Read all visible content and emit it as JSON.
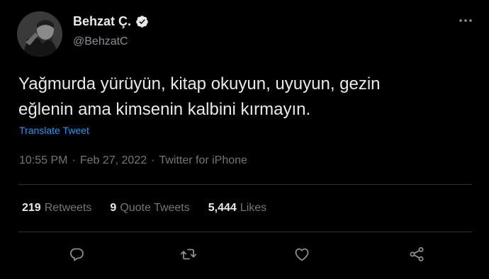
{
  "author": {
    "name": "Behzat Ç.",
    "handle": "@BehzatC"
  },
  "tweet": {
    "text": "Yağmurda yürüyün, kitap okuyun, uyuyun, gezin\neğlenin ama kimsenin kalbini kırmayın.",
    "translate_label": "Translate Tweet",
    "time": "10:55 PM",
    "date": "Feb 27, 2022",
    "source": "Twitter for iPhone",
    "separator": "·"
  },
  "stats": {
    "retweets_count": "219",
    "retweets_label": "Retweets",
    "quotes_count": "9",
    "quotes_label": "Quote Tweets",
    "likes_count": "5,444",
    "likes_label": "Likes"
  },
  "icons": {
    "verified": "verified-badge-icon",
    "more": "more-options-icon",
    "reply": "reply-icon",
    "retweet": "retweet-icon",
    "like": "heart-icon",
    "share": "share-icon"
  },
  "colors": {
    "background": "#000000",
    "text": "#e7e9ea",
    "muted": "#71767b",
    "link": "#1d9bf0"
  }
}
